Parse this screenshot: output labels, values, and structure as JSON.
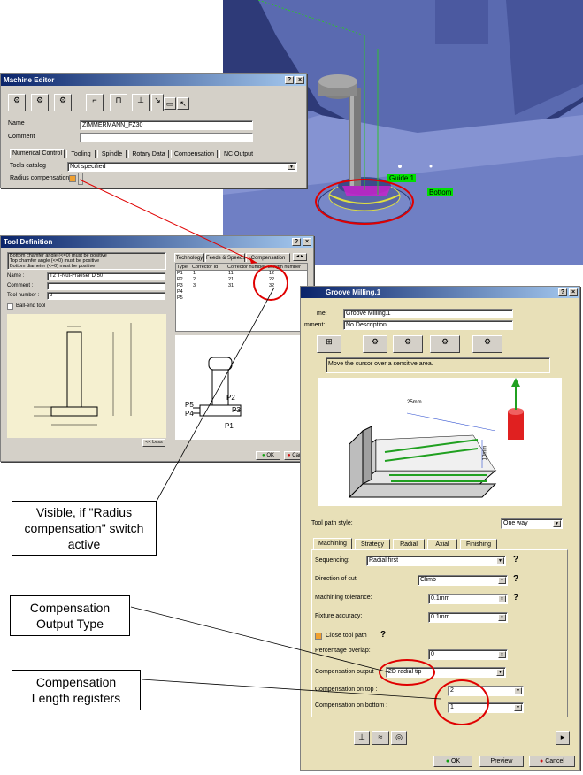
{
  "viewport3d": {
    "label_guide": "Guide 1",
    "label_bottom": "Bottom"
  },
  "machine_editor": {
    "title": "Machine Editor",
    "name_label": "Name",
    "name_value": "ZIMMERMANN_FZ30",
    "comment_label": "Comment",
    "comment_value": "",
    "tabs": [
      "Numerical Control",
      "Tooling",
      "Spindle",
      "Rotary Data",
      "Compensation",
      "NC Output"
    ],
    "tools_catalog_label": "Tools catalog",
    "tools_catalog_value": "Not specified",
    "radius_comp_label": "Radius compensation"
  },
  "tool_definition": {
    "title": "Tool Definition",
    "messages": [
      "Bottom chamfer angle (<=0) must be positive",
      "Top chamfer angle (<=0) must be positive",
      "Bottom diameter (<=0) must be positive"
    ],
    "name_label": "Name :",
    "name_value": "T2 T-Nut-Fraeser D 50",
    "comment_label": "Comment :",
    "tool_number_label": "Tool number :",
    "tool_number_value": "2",
    "ball_end_label": "Ball-end tool",
    "tabs": [
      "Technology",
      "Feeds & Speeds",
      "Compensation"
    ],
    "table_headers": [
      "Type",
      "Corrector Id",
      "Corrector number",
      "Length number"
    ],
    "table_rows": [
      [
        "P1",
        "1",
        "11",
        "12"
      ],
      [
        "P2",
        "2",
        "21",
        "22"
      ],
      [
        "P3",
        "3",
        "31",
        "32"
      ],
      [
        "P4",
        "",
        "",
        ""
      ],
      [
        "P5",
        "",
        "",
        ""
      ]
    ],
    "less_button": "<< Less",
    "ok_button": "OK",
    "cancel_button": "Cancel",
    "diagram_labels": [
      "P5",
      "P4",
      "P3",
      "P2",
      "P1"
    ]
  },
  "groove_milling": {
    "title": "Groove Milling.1",
    "name_label": "me:",
    "name_value": "Groove Milling.1",
    "comment_label": "mment:",
    "comment_value": "No Description",
    "hint": "Move the cursor over a sensitive area.",
    "dim_25": "25mm",
    "dim_10": "10mm",
    "tool_path_style_label": "Tool path style:",
    "tool_path_style_value": "One way",
    "tabs": [
      "Machining",
      "Strategy",
      "Radial",
      "Axial",
      "Finishing"
    ],
    "sequencing_label": "Sequencing:",
    "sequencing_value": "Radial first",
    "direction_label": "Direction of cut:",
    "direction_value": "Climb",
    "tolerance_label": "Machining tolerance:",
    "tolerance_value": "0.1mm",
    "fixture_label": "Fixture accuracy:",
    "fixture_value": "0.1mm",
    "close_path_label": "Close tool path",
    "overlap_label": "Percentage overlap:",
    "overlap_value": "0",
    "comp_output_label": "Compensation output",
    "comp_output_value": "2D radial tip",
    "comp_top_label": "Compensation on top :",
    "comp_top_value": "2",
    "comp_bottom_label": "Compensation on bottom :",
    "comp_bottom_value": "1",
    "ok_button": "OK",
    "preview_button": "Preview",
    "cancel_button": "Cancel"
  },
  "callouts": {
    "visible_if": "Visible, if \"Radius compensation\" switch active",
    "output_type": "Compensation Output Type",
    "length_registers": "Compensation Length registers"
  }
}
